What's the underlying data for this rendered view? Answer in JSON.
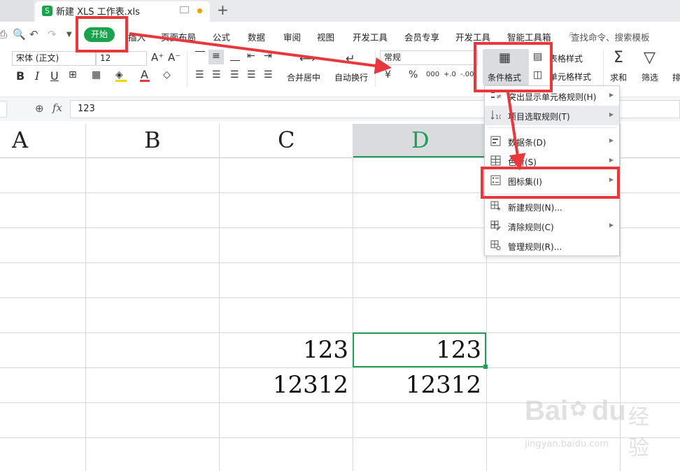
{
  "tab": {
    "file_logo": "S",
    "file_name": "新建 XLS 工作表.xls",
    "add": "+"
  },
  "menu": {
    "start": "开始",
    "items": [
      "插入",
      "页面布局",
      "公式",
      "数据",
      "审阅",
      "视图",
      "开发工具",
      "会员专享",
      "开发工具",
      "智能工具箱"
    ],
    "search": "查找命令、搜索模板"
  },
  "toolbar": {
    "font": "宋体 (正文)",
    "size": "12",
    "grow": "A⁺",
    "shrink": "A⁻",
    "bold": "B",
    "italic": "I",
    "underline": "U",
    "merge": "合并居中",
    "wrap": "自动换行",
    "number_format": "常规",
    "currency": "¥",
    "percent": "%",
    "thousands": "000",
    "dec_inc": "+.0",
    "dec_dec": "-.00",
    "cond_format": "条件格式",
    "table_style": "表格样式",
    "cell_style": "单元格样式",
    "sum": "求和",
    "filter": "筛选",
    "sort": "排"
  },
  "formula": {
    "fx": "fx",
    "value": "123"
  },
  "grid": {
    "columns": [
      "A",
      "B",
      "C",
      "D"
    ],
    "cells": {
      "C_row6": "123",
      "D_row6": "123",
      "C_row7": "12312",
      "D_row7": "12312"
    }
  },
  "dropdown": {
    "items": [
      {
        "label": "突出显示单元格规则(H)",
        "icon": "highlight-rules-icon",
        "arrow": true
      },
      {
        "label": "项目选取规则(T)",
        "icon": "top-bottom-rules-icon",
        "arrow": true
      },
      {
        "label": "数据条(D)",
        "icon": "data-bars-icon",
        "arrow": true
      },
      {
        "label": "色阶(S)",
        "icon": "color-scales-icon",
        "arrow": true
      },
      {
        "label": "图标集(I)",
        "icon": "icon-sets-icon",
        "arrow": true
      },
      {
        "label": "新建规则(N)...",
        "icon": "new-rule-icon",
        "arrow": false
      },
      {
        "label": "清除规则(C)",
        "icon": "clear-rules-icon",
        "arrow": true
      },
      {
        "label": "管理规则(R)...",
        "icon": "manage-rules-icon",
        "arrow": false
      }
    ]
  },
  "watermark": {
    "brand": "Bai",
    "brand2": "du",
    "cn": "经验",
    "url": "jingyan.baidu.com"
  },
  "colors": {
    "accent": "#1aa24c",
    "annotation": "#e8383d",
    "selection": "#1e9e58"
  }
}
